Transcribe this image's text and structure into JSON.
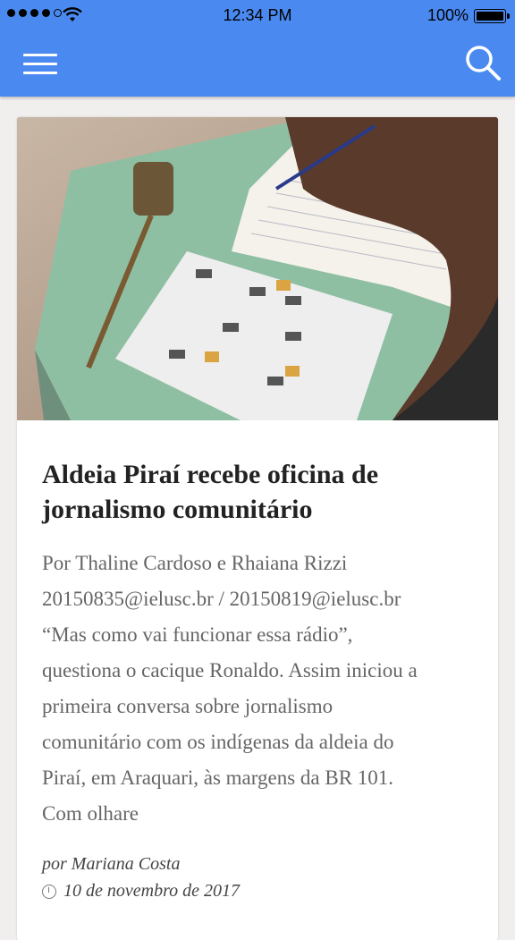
{
  "status_bar": {
    "time": "12:34 PM",
    "battery": "100%",
    "signal_icon": "signal-dots-icon",
    "wifi_icon": "wifi-icon"
  },
  "app_bar": {
    "menu_icon": "hamburger-menu-icon",
    "search_icon": "search-icon",
    "color": "#4a8af0"
  },
  "post": {
    "image_description_icon": "article-photo",
    "title": "Aldeia Piraí recebe oficina de jornalismo comunitário",
    "excerpt_lines": [
      "Por Thaline Cardoso e Rhaiana Rizzi",
      "20150835@ielusc.br / 20150819@ielusc.br",
      "“Mas como vai funcionar essa rádio”,",
      "questiona o cacique Ronaldo. Assim iniciou a",
      "primeira conversa sobre jornalismo",
      "comunitário com os indígenas da aldeia do",
      "Piraí, em Araquari, às margens da BR 101.",
      "Com olhare"
    ],
    "author": "por Mariana Costa",
    "date": "10 de novembro de 2017"
  }
}
